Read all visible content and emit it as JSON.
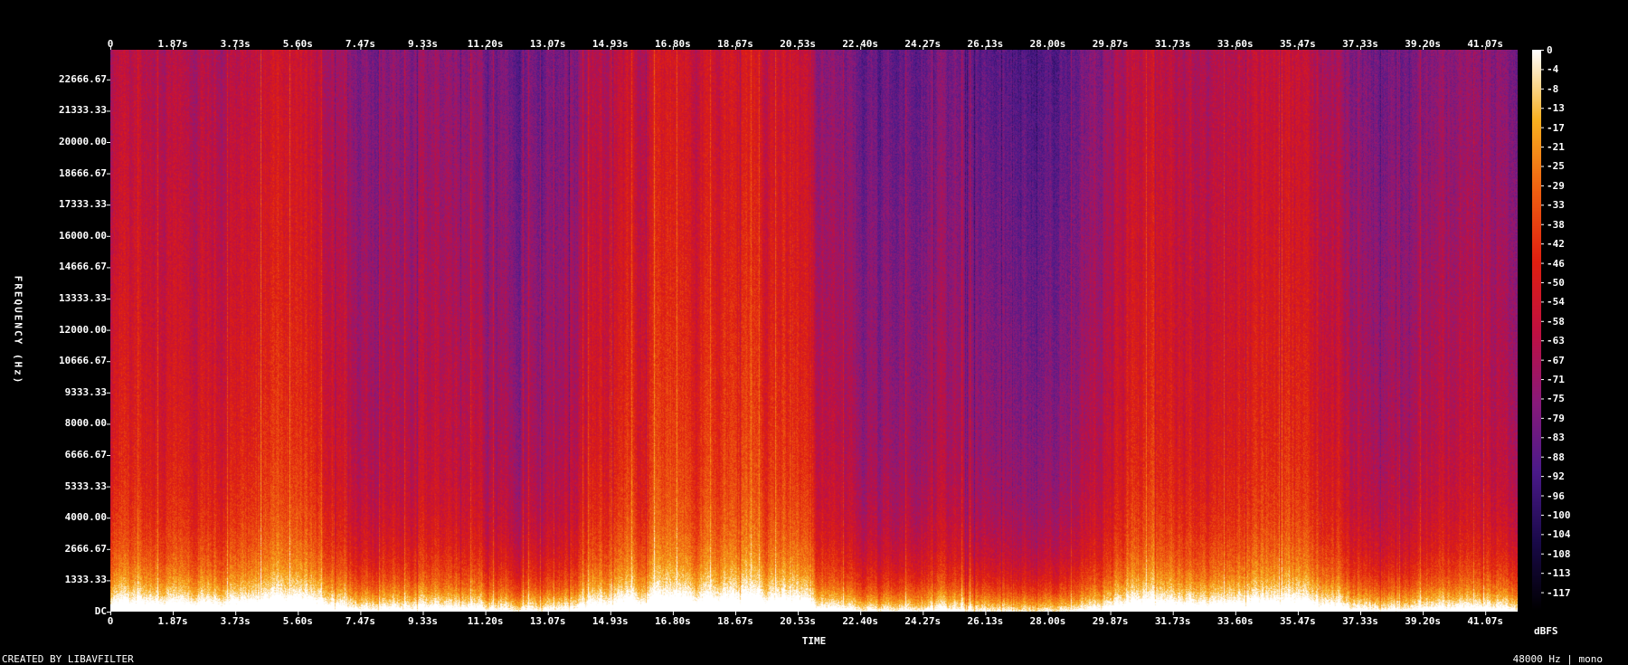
{
  "chart_data": {
    "type": "heatmap",
    "subtype": "spectrogram",
    "xlabel": "TIME",
    "ylabel": "FREQUENCY (Hz)",
    "x_ticks": [
      "0",
      "1.87s",
      "3.73s",
      "5.60s",
      "7.47s",
      "9.33s",
      "11.20s",
      "13.07s",
      "14.93s",
      "16.80s",
      "18.67s",
      "20.53s",
      "22.40s",
      "24.27s",
      "26.13s",
      "28.00s",
      "29.87s",
      "31.73s",
      "33.60s",
      "35.47s",
      "37.33s",
      "39.20s",
      "41.07s"
    ],
    "y_ticks": [
      "DC",
      "1333.33",
      "2666.67",
      "4000.00",
      "5333.33",
      "6666.67",
      "8000.00",
      "9333.33",
      "10666.67",
      "12000.00",
      "13333.33",
      "14666.67",
      "16000.00",
      "17333.33",
      "18666.67",
      "20000.00",
      "21333.33",
      "22666.67"
    ],
    "xlim": [
      0,
      42.2
    ],
    "ylim": [
      0,
      24000
    ],
    "colorbar": {
      "label": "dBFS",
      "ticks": [
        "0",
        "-4",
        "-8",
        "-13",
        "-17",
        "-21",
        "-25",
        "-29",
        "-33",
        "-38",
        "-42",
        "-46",
        "-50",
        "-54",
        "-58",
        "-63",
        "-67",
        "-71",
        "-75",
        "-79",
        "-83",
        "-88",
        "-92",
        "-96",
        "-100",
        "-104",
        "-108",
        "-113",
        "-117"
      ],
      "range": [
        -120,
        0
      ]
    },
    "colormap": [
      "#000000",
      "#1a0a4a",
      "#4b1a8a",
      "#8a1a7a",
      "#c01040",
      "#e02010",
      "#f06010",
      "#f8b020",
      "#ffffff"
    ]
  },
  "footer": {
    "credit": "CREATED BY LIBAVFILTER",
    "format": "48000 Hz | mono"
  }
}
